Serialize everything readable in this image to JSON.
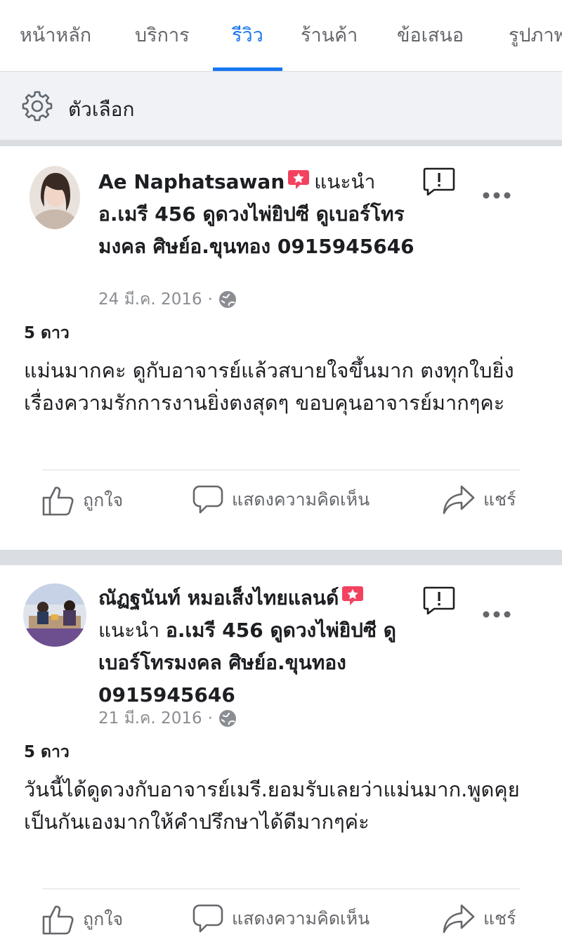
{
  "tabs": [
    {
      "label": "หน้าหลัก",
      "active": false
    },
    {
      "label": "บริการ",
      "active": false
    },
    {
      "label": "รีวิว",
      "active": true
    },
    {
      "label": "ร้านค้า",
      "active": false
    },
    {
      "label": "ข้อเสนอ",
      "active": false
    },
    {
      "label": "รูปภาพ",
      "active": false
    }
  ],
  "options": {
    "label": "ตัวเลือก",
    "icon": "gear-icon"
  },
  "reviews": [
    {
      "reviewer": "Ae Naphatsawan",
      "recommends": "แนะนำ",
      "page_name": "อ.เมรี 456 ดูดวงไพ่ยิปซี ดูเบอร์โทรมงคล ศิษย์อ.ขุนทอง 0915945646",
      "date": "24 มี.ค. 2016",
      "privacy_icon": "globe-icon",
      "stars": "5 ดาว",
      "text": "แม่นมากคะ ดูกับอาจารย์แล้วสบายใจขึ้นมาก ตงทุกใบยิ่งเรื่องความรักการงานยิ่งตงสุดๆ ขอบคุนอาจารย์มากๆคะ"
    },
    {
      "reviewer": "ณัฏฐนันท์ หมอเส็งไทยแลนด์",
      "recommends": "แนะนำ",
      "page_name": "อ.เมรี 456 ดูดวงไพ่ยิปซี ดูเบอร์โทรมงคล ศิษย์อ.ขุนทอง 0915945646",
      "date": "21 มี.ค. 2016",
      "privacy_icon": "globe-icon",
      "stars": "5 ดาว",
      "text": "วันนี้ได้ดูดวงกับอาจารย์เมรี.ยอมรับเลยว่าแม่นมาก.พูดคุยเป็นกันเองมากให้คำปรึกษาได้ดีมากๆค่ะ"
    }
  ],
  "actions": {
    "like": "ถูกใจ",
    "comment": "แสดงความคิดเห็น",
    "share": "แชร์"
  },
  "colors": {
    "accent": "#1877f2",
    "muted": "#65676b",
    "badge": "#f3425f",
    "divider": "#dadde1"
  }
}
